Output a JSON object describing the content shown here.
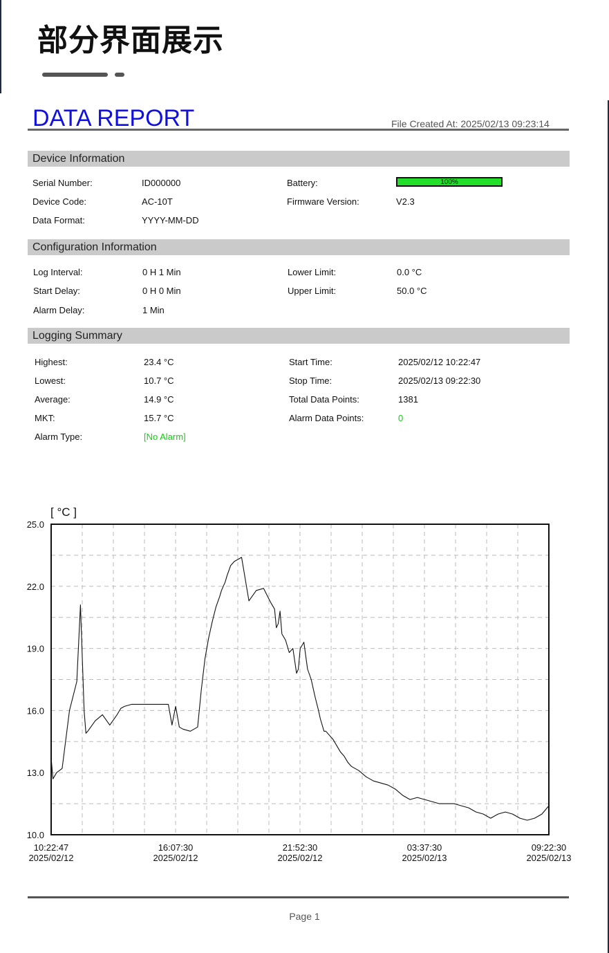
{
  "banner": {
    "title": "部分界面展示"
  },
  "report": {
    "title": "DATA REPORT",
    "file_created_label": "File Created At:",
    "file_created_value": "2025/02/13 09:23:14"
  },
  "device_info": {
    "heading": "Device Information",
    "serial_label": "Serial Number:",
    "serial_value": "ID000000",
    "code_label": "Device Code:",
    "code_value": "AC-10T",
    "format_label": "Data Format:",
    "format_value": "YYYY-MM-DD",
    "battery_label": "Battery:",
    "battery_percent": 100,
    "battery_text": "100%",
    "firmware_label": "Firmware Version:",
    "firmware_value": "V2.3"
  },
  "config_info": {
    "heading": "Configuration Information",
    "log_interval_label": "Log Interval:",
    "log_interval_value": "0 H 1 Min",
    "start_delay_label": "Start Delay:",
    "start_delay_value": "0 H 0 Min",
    "alarm_delay_label": "Alarm Delay:",
    "alarm_delay_value": "1 Min",
    "lower_limit_label": "Lower Limit:",
    "lower_limit_value": "0.0 °C",
    "upper_limit_label": "Upper Limit:",
    "upper_limit_value": "50.0 °C"
  },
  "logging_summary": {
    "heading": "Logging Summary",
    "highest_label": "Highest:",
    "highest_value": "23.4 °C",
    "lowest_label": "Lowest:",
    "lowest_value": "10.7 °C",
    "average_label": "Average:",
    "average_value": "14.9 °C",
    "mkt_label": "MKT:",
    "mkt_value": "15.7 °C",
    "alarm_type_label": "Alarm Type:",
    "alarm_type_value": "[No Alarm]",
    "start_time_label": "Start Time:",
    "start_time_value": "2025/02/12 10:22:47",
    "stop_time_label": "Stop Time:",
    "stop_time_value": "2025/02/13 09:22:30",
    "total_points_label": "Total Data Points:",
    "total_points_value": "1381",
    "alarm_points_label": "Alarm Data Points:",
    "alarm_points_value": "0"
  },
  "colors": {
    "title_blue": "#1010e0",
    "battery_green": "#22e02a",
    "ok_green": "#10d010",
    "section_gray": "#cacaca"
  },
  "chart_data": {
    "type": "line",
    "ylabel": "[ °C ]",
    "ylim": [
      10.0,
      25.0
    ],
    "yticks": [
      "25.0",
      "22.0",
      "19.0",
      "16.0",
      "13.0",
      "10.0"
    ],
    "xticks": [
      {
        "time": "10:22:47",
        "date": "2025/02/12"
      },
      {
        "time": "16:07:30",
        "date": "2025/02/12"
      },
      {
        "time": "21:52:30",
        "date": "2025/02/12"
      },
      {
        "time": "03:37:30",
        "date": "2025/02/13"
      },
      {
        "time": "09:22:30",
        "date": "2025/02/13"
      }
    ],
    "grid": true,
    "series": [
      {
        "x_minutes": [
          0,
          5,
          15,
          30,
          50,
          70,
          80,
          90,
          95,
          100,
          120,
          140,
          160,
          180,
          190,
          200,
          220,
          240,
          260,
          280,
          300,
          320,
          330,
          340,
          350,
          360,
          380,
          400,
          410,
          420,
          430,
          440,
          450,
          460,
          465,
          470,
          475,
          480,
          490,
          500,
          520,
          540,
          560,
          580,
          600,
          610,
          615,
          620,
          625,
          630,
          640,
          650,
          660,
          670,
          675,
          680,
          690,
          700,
          710,
          720,
          730,
          735,
          740,
          745,
          750,
          760,
          770,
          780,
          790,
          800,
          810,
          820,
          840,
          860,
          880,
          900,
          920,
          940,
          960,
          980,
          1000,
          1020,
          1040,
          1060,
          1080,
          1100,
          1120,
          1140,
          1160,
          1180,
          1200,
          1220,
          1240,
          1260,
          1280,
          1300,
          1320,
          1340,
          1359
        ],
        "values": [
          13.7,
          12.7,
          13.0,
          13.2,
          16.0,
          17.4,
          21.1,
          16.0,
          14.9,
          15.0,
          15.5,
          15.8,
          15.3,
          15.8,
          16.1,
          16.2,
          16.3,
          16.3,
          16.3,
          16.3,
          16.3,
          16.3,
          15.3,
          16.2,
          15.2,
          15.1,
          15.0,
          15.2,
          17.0,
          18.5,
          19.5,
          20.3,
          21.0,
          21.5,
          21.8,
          22.0,
          22.2,
          22.5,
          23.0,
          23.2,
          23.4,
          21.3,
          21.8,
          21.9,
          21.2,
          20.9,
          20.0,
          20.2,
          20.8,
          19.7,
          19.4,
          18.8,
          19.0,
          17.8,
          18.0,
          19.0,
          19.3,
          18.0,
          17.5,
          16.7,
          16.0,
          15.6,
          15.3,
          15.0,
          15.0,
          14.8,
          14.6,
          14.3,
          14.0,
          13.8,
          13.5,
          13.3,
          13.1,
          12.8,
          12.6,
          12.5,
          12.4,
          12.2,
          11.9,
          11.7,
          11.8,
          11.7,
          11.6,
          11.5,
          11.5,
          11.5,
          11.4,
          11.3,
          11.1,
          11.0,
          10.8,
          11.0,
          11.1,
          11.0,
          10.8,
          10.7,
          10.8,
          11.0,
          11.4
        ]
      }
    ]
  },
  "footer": {
    "page": "Page 1"
  }
}
